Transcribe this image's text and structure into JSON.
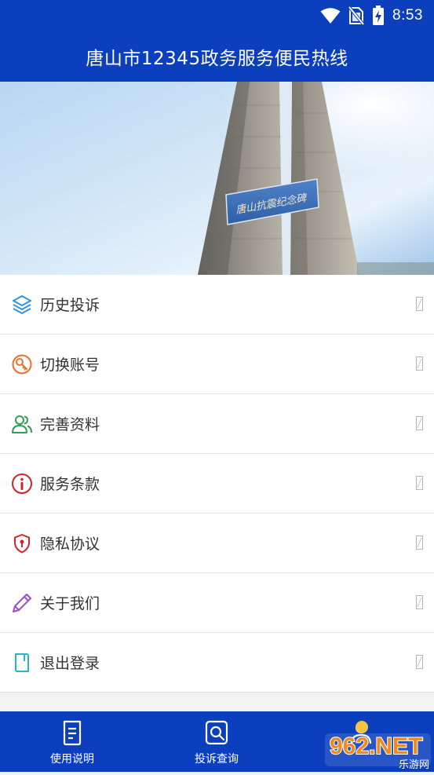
{
  "status_bar": {
    "time": "8:53",
    "icons": [
      "wifi-icon",
      "no-sim-icon",
      "battery-charging-icon"
    ]
  },
  "header": {
    "title": "唐山市12345政务服务便民热线"
  },
  "banner": {
    "image": "monument-photo",
    "plaque_text": "唐山抗震纪念碑"
  },
  "menu": {
    "items": [
      {
        "label": "历史投诉",
        "icon": "layers-icon",
        "color": "#2f93e6"
      },
      {
        "label": "切换账号",
        "icon": "key-icon",
        "color": "#e8702a"
      },
      {
        "label": "完善资料",
        "icon": "users-icon",
        "color": "#2f9e55"
      },
      {
        "label": "服务条款",
        "icon": "info-icon",
        "color": "#d2232a"
      },
      {
        "label": "隐私协议",
        "icon": "shield-icon",
        "color": "#d2232a"
      },
      {
        "label": "关于我们",
        "icon": "pencil-icon",
        "color": "#9b4fc2"
      },
      {
        "label": "退出登录",
        "icon": "document-icon",
        "color": "#29b6c9"
      }
    ]
  },
  "bottom_nav": {
    "items": [
      {
        "label": "使用说明",
        "icon": "manual-icon"
      },
      {
        "label": "投诉查询",
        "icon": "search-icon"
      },
      {
        "label": "",
        "icon": "user-icon"
      }
    ]
  },
  "watermark": {
    "brand": "962.NET",
    "subtitle": "乐游网"
  },
  "colors": {
    "primary": "#0b3fbd",
    "text": "#333333",
    "divider": "#e3e3e3"
  }
}
